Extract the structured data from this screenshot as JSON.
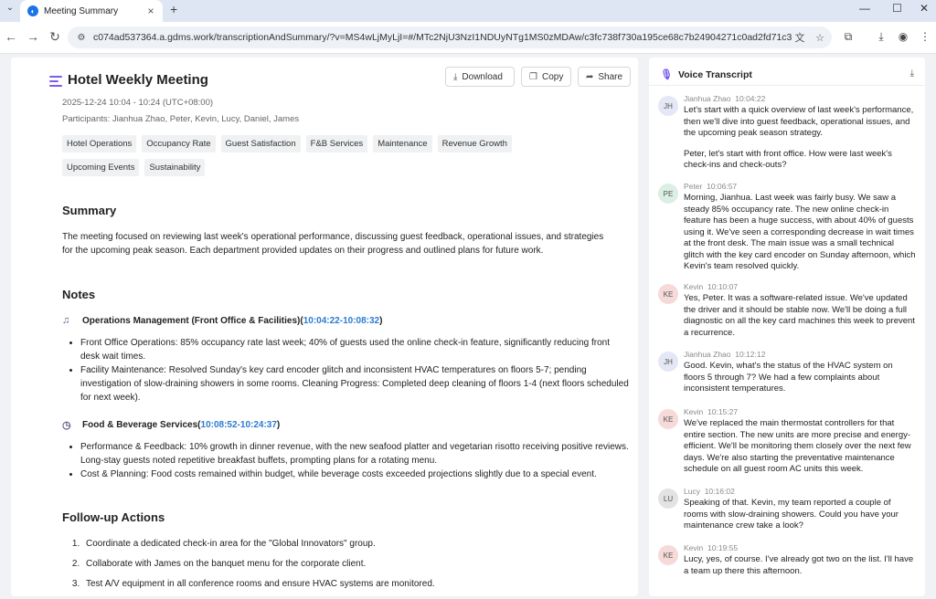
{
  "browser": {
    "tab_title": "Meeting Summary",
    "url": "c074ad537364.a.gdms.work/transcriptionAndSummary/?v=MS4wLjMyLjI=#/MTc2NjU3NzI1NDUyNTg1MS0zMDAw/c3fc738f730a195ce68c7b24904271c0ad2fd71c3...",
    "icons": [
      "tab-search-icon",
      "close-icon",
      "plus-icon",
      "minimize-icon",
      "maximize-icon",
      "close-window-icon",
      "back-icon",
      "forward-icon",
      "reload-icon",
      "site-settings-icon",
      "translate-icon",
      "bookmark-star-icon",
      "extensions-icon",
      "download-icon",
      "profile-icon",
      "more-icon"
    ]
  },
  "meeting": {
    "title": "Hotel Weekly Meeting",
    "datetime": "2025-12-24 10:04 - 10:24 (UTC+08:00)",
    "participants": "Participants: Jianhua Zhao, Peter, Kevin, Lucy, Daniel, James",
    "tags": [
      "Hotel Operations",
      "Occupancy Rate",
      "Guest Satisfaction",
      "F&B Services",
      "Maintenance",
      "Revenue Growth",
      "Upcoming Events",
      "Sustainability"
    ]
  },
  "actions": {
    "download": "Download",
    "copy": "Copy",
    "share": "Share"
  },
  "summary": {
    "heading": "Summary",
    "text": "The meeting focused on reviewing last week's operational performance, discussing guest feedback, operational issues, and strategies for the upcoming peak season. Each department provided updates on their progress and outlined plans for future work."
  },
  "notes": {
    "heading": "Notes",
    "sections": [
      {
        "title": "Operations Management (Front Office & Facilities)",
        "open": "(",
        "start": "10:04:22",
        "sep": " - ",
        "end": "10:08:32",
        "close": ")",
        "bullets": [
          "Front Office Operations: 85% occupancy rate last week; 40% of guests used the online check-in feature, significantly reducing front desk wait times.",
          "Facility Maintenance: Resolved Sunday's key card encoder glitch and inconsistent HVAC temperatures on floors 5-7; pending investigation of slow-draining showers in some rooms. Cleaning Progress: Completed deep cleaning of floors 1-4 (next floors scheduled for next week)."
        ]
      },
      {
        "title": "Food & Beverage Services",
        "open": "(",
        "start": "10:08:52",
        "sep": " - ",
        "end": "10:24:37",
        "close": ")",
        "bullets": [
          "Performance & Feedback: 10% growth in dinner revenue, with the new seafood platter and vegetarian risotto receiving positive reviews. Long-stay guests noted repetitive breakfast buffets, prompting plans for a rotating menu.",
          "Cost & Planning: Food costs remained within budget, while beverage costs exceeded projections slightly due to a special event."
        ]
      }
    ]
  },
  "followup": {
    "heading": "Follow-up Actions",
    "items": [
      "Coordinate a dedicated check-in area for the \"Global Innovators\" group.",
      "Collaborate with James on the banquet menu for the corporate client.",
      "Test A/V equipment in all conference rooms and ensure HVAC systems are monitored."
    ]
  },
  "transcript": {
    "heading": "Voice Transcript",
    "entries": [
      {
        "initials": "JH",
        "speaker": "Jianhua Zhao",
        "time": "10:04:22",
        "color": "#e4e7f5",
        "paras": [
          "Let's start with a quick overview of last week's performance, then we'll dive into guest feedback, operational issues, and the upcoming peak season strategy.",
          "Peter, let's start with front office. How were last week's check-ins and check-outs?"
        ]
      },
      {
        "initials": "PE",
        "speaker": "Peter",
        "time": "10:06:57",
        "color": "#dcefe4",
        "paras": [
          "Morning, Jianhua. Last week was fairly busy. We saw a steady 85% occupancy rate. The new online check-in feature has been a huge success, with about 40% of guests using it. We've seen a corresponding decrease in wait times at the front desk. The main issue was a small technical glitch with the key card encoder on Sunday afternoon, which Kevin's team resolved quickly."
        ]
      },
      {
        "initials": "KE",
        "speaker": "Kevin",
        "time": "10:10:07",
        "color": "#f6d9d9",
        "paras": [
          "Yes, Peter. It was a software-related issue. We've updated the driver and it should be stable now. We'll be doing a full diagnostic on all the key card machines this week to prevent a recurrence."
        ]
      },
      {
        "initials": "JH",
        "speaker": "Jianhua Zhao",
        "time": "10:12:12",
        "color": "#e4e7f5",
        "paras": [
          "Good. Kevin, what's the status of the HVAC system on floors 5 through 7? We had a few complaints about inconsistent temperatures."
        ]
      },
      {
        "initials": "KE",
        "speaker": "Kevin",
        "time": "10:15:27",
        "color": "#f6d9d9",
        "paras": [
          "We've replaced the main thermostat controllers for that entire section. The new units are more precise and energy-efficient. We'll be monitoring them closely over the next few days. We're also starting the preventative maintenance schedule on all guest room AC units this week."
        ]
      },
      {
        "initials": "LU",
        "speaker": "Lucy",
        "time": "10:16:02",
        "color": "#e3e3e3",
        "paras": [
          "Speaking of that. Kevin, my team reported a couple of rooms with slow-draining showers. Could you have your maintenance crew take a look?"
        ]
      },
      {
        "initials": "KE",
        "speaker": "Kevin",
        "time": "10:19:55",
        "color": "#f6d9d9",
        "paras": [
          "Lucy, yes, of course. I've already got two on the list. I'll have a team up there this afternoon."
        ]
      }
    ]
  }
}
